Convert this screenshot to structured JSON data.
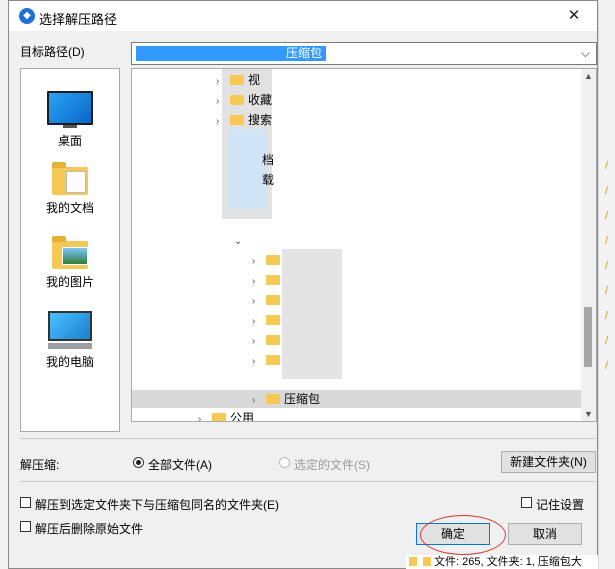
{
  "dialog": {
    "title": "选择解压路径",
    "close_glyph": "✕"
  },
  "destination": {
    "label": "目标路径(D)",
    "path_value": "压缩包"
  },
  "places": [
    {
      "label": "桌面"
    },
    {
      "label": "我的文档"
    },
    {
      "label": "我的图片"
    },
    {
      "label": "我的电脑"
    }
  ],
  "tree": {
    "rows": [
      {
        "text": "视"
      },
      {
        "text": "收藏"
      },
      {
        "text": "搜索"
      },
      {
        "text": "档"
      },
      {
        "text": "载"
      },
      {
        "text": "压缩包"
      },
      {
        "text": "公用"
      }
    ]
  },
  "extract": {
    "label": "解压缩:",
    "option_all": "全部文件(A)",
    "option_selected": "选定的文件(S)",
    "new_folder": "新建文件夹(N)"
  },
  "options": {
    "same_name_folder": "解压到选定文件夹下与压缩包同名的文件夹(E)",
    "delete_original": "解压后删除原始文件",
    "remember": "记住设置"
  },
  "buttons": {
    "ok": "确定",
    "cancel": "取消"
  },
  "status": {
    "text": "文件: 265, 文件夹: 1, 压缩包大"
  },
  "icons": [
    "close-icon",
    "chevron-down-icon",
    "desktop-icon",
    "folder-documents-icon",
    "folder-pictures-icon",
    "computer-icon",
    "folder-icon",
    "expand-arrow-icon"
  ]
}
